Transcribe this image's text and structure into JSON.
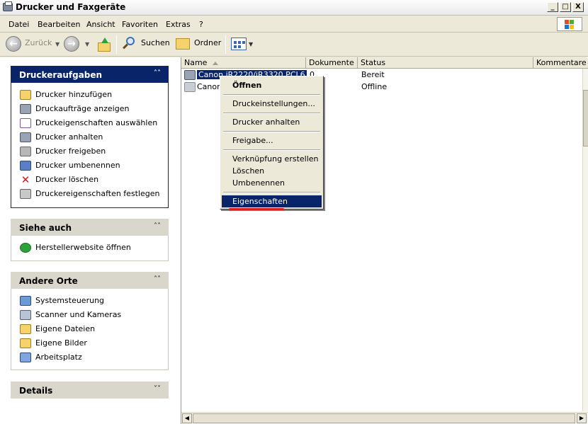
{
  "window": {
    "title": "Drucker und Faxgeräte",
    "controls": [
      "_",
      "□",
      "X"
    ]
  },
  "menubar": {
    "items": [
      "Datei",
      "Bearbeiten",
      "Ansicht",
      "Favoriten",
      "Extras",
      "?"
    ]
  },
  "toolbar": {
    "back_label": "Zurück",
    "search_label": "Suchen",
    "folders_label": "Ordner"
  },
  "taskpane": {
    "printer_tasks": {
      "title": "Druckeraufgaben",
      "items": [
        {
          "label": "Drucker hinzufügen",
          "icon": "add-printer-icon"
        },
        {
          "label": "Druckaufträge anzeigen",
          "icon": "print-jobs-icon"
        },
        {
          "label": "Druckeigenschaften auswählen",
          "icon": "print-preferences-icon"
        },
        {
          "label": "Drucker anhalten",
          "icon": "pause-printer-icon"
        },
        {
          "label": "Drucker freigeben",
          "icon": "share-printer-icon"
        },
        {
          "label": "Drucker umbenennen",
          "icon": "rename-printer-icon"
        },
        {
          "label": "Drucker löschen",
          "icon": "delete-icon"
        },
        {
          "label": "Druckereigenschaften festlegen",
          "icon": "printer-properties-icon"
        }
      ]
    },
    "see_also": {
      "title": "Siehe auch",
      "items": [
        {
          "label": "Herstellerwebsite öffnen",
          "icon": "website-icon"
        }
      ]
    },
    "other_places": {
      "title": "Andere Orte",
      "items": [
        {
          "label": "Systemsteuerung",
          "icon": "control-panel-icon"
        },
        {
          "label": "Scanner und Kameras",
          "icon": "scanner-camera-icon"
        },
        {
          "label": "Eigene Dateien",
          "icon": "my-documents-icon"
        },
        {
          "label": "Eigene Bilder",
          "icon": "my-pictures-icon"
        },
        {
          "label": "Arbeitsplatz",
          "icon": "my-computer-icon"
        }
      ]
    },
    "details": {
      "title": "Details"
    }
  },
  "list": {
    "columns": [
      "Name",
      "Dokumente",
      "Status",
      "Kommentare"
    ],
    "rows": [
      {
        "name": "Canon iR2220/iR3320 PCL6",
        "documents": "0",
        "status": "Bereit"
      },
      {
        "name": "Canon",
        "documents": "",
        "status": "Offline"
      }
    ]
  },
  "context_menu": {
    "open": "Öffnen",
    "printing_preferences": "Druckeinstellungen...",
    "pause_printing": "Drucker anhalten",
    "sharing": "Freigabe...",
    "create_shortcut": "Verknüpfung erstellen",
    "delete": "Löschen",
    "rename": "Umbenennen",
    "properties": "Eigenschaften"
  },
  "colors": {
    "selection": "#0a246a",
    "annotation_underline": "#e01b1b",
    "panel_header": "#d9d7cc"
  }
}
